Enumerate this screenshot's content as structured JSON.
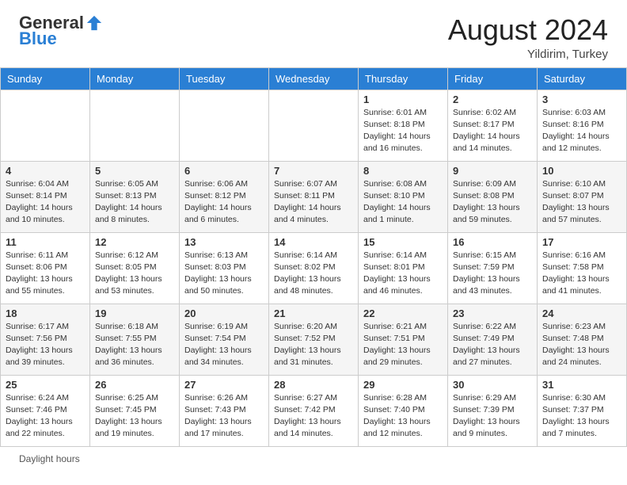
{
  "header": {
    "logo_general": "General",
    "logo_blue": "Blue",
    "month_year": "August 2024",
    "location": "Yildirim, Turkey"
  },
  "days_of_week": [
    "Sunday",
    "Monday",
    "Tuesday",
    "Wednesday",
    "Thursday",
    "Friday",
    "Saturday"
  ],
  "weeks": [
    [
      {
        "day": "",
        "info": ""
      },
      {
        "day": "",
        "info": ""
      },
      {
        "day": "",
        "info": ""
      },
      {
        "day": "",
        "info": ""
      },
      {
        "day": "1",
        "info": "Sunrise: 6:01 AM\nSunset: 8:18 PM\nDaylight: 14 hours\nand 16 minutes."
      },
      {
        "day": "2",
        "info": "Sunrise: 6:02 AM\nSunset: 8:17 PM\nDaylight: 14 hours\nand 14 minutes."
      },
      {
        "day": "3",
        "info": "Sunrise: 6:03 AM\nSunset: 8:16 PM\nDaylight: 14 hours\nand 12 minutes."
      }
    ],
    [
      {
        "day": "4",
        "info": "Sunrise: 6:04 AM\nSunset: 8:14 PM\nDaylight: 14 hours\nand 10 minutes."
      },
      {
        "day": "5",
        "info": "Sunrise: 6:05 AM\nSunset: 8:13 PM\nDaylight: 14 hours\nand 8 minutes."
      },
      {
        "day": "6",
        "info": "Sunrise: 6:06 AM\nSunset: 8:12 PM\nDaylight: 14 hours\nand 6 minutes."
      },
      {
        "day": "7",
        "info": "Sunrise: 6:07 AM\nSunset: 8:11 PM\nDaylight: 14 hours\nand 4 minutes."
      },
      {
        "day": "8",
        "info": "Sunrise: 6:08 AM\nSunset: 8:10 PM\nDaylight: 14 hours\nand 1 minute."
      },
      {
        "day": "9",
        "info": "Sunrise: 6:09 AM\nSunset: 8:08 PM\nDaylight: 13 hours\nand 59 minutes."
      },
      {
        "day": "10",
        "info": "Sunrise: 6:10 AM\nSunset: 8:07 PM\nDaylight: 13 hours\nand 57 minutes."
      }
    ],
    [
      {
        "day": "11",
        "info": "Sunrise: 6:11 AM\nSunset: 8:06 PM\nDaylight: 13 hours\nand 55 minutes."
      },
      {
        "day": "12",
        "info": "Sunrise: 6:12 AM\nSunset: 8:05 PM\nDaylight: 13 hours\nand 53 minutes."
      },
      {
        "day": "13",
        "info": "Sunrise: 6:13 AM\nSunset: 8:03 PM\nDaylight: 13 hours\nand 50 minutes."
      },
      {
        "day": "14",
        "info": "Sunrise: 6:14 AM\nSunset: 8:02 PM\nDaylight: 13 hours\nand 48 minutes."
      },
      {
        "day": "15",
        "info": "Sunrise: 6:14 AM\nSunset: 8:01 PM\nDaylight: 13 hours\nand 46 minutes."
      },
      {
        "day": "16",
        "info": "Sunrise: 6:15 AM\nSunset: 7:59 PM\nDaylight: 13 hours\nand 43 minutes."
      },
      {
        "day": "17",
        "info": "Sunrise: 6:16 AM\nSunset: 7:58 PM\nDaylight: 13 hours\nand 41 minutes."
      }
    ],
    [
      {
        "day": "18",
        "info": "Sunrise: 6:17 AM\nSunset: 7:56 PM\nDaylight: 13 hours\nand 39 minutes."
      },
      {
        "day": "19",
        "info": "Sunrise: 6:18 AM\nSunset: 7:55 PM\nDaylight: 13 hours\nand 36 minutes."
      },
      {
        "day": "20",
        "info": "Sunrise: 6:19 AM\nSunset: 7:54 PM\nDaylight: 13 hours\nand 34 minutes."
      },
      {
        "day": "21",
        "info": "Sunrise: 6:20 AM\nSunset: 7:52 PM\nDaylight: 13 hours\nand 31 minutes."
      },
      {
        "day": "22",
        "info": "Sunrise: 6:21 AM\nSunset: 7:51 PM\nDaylight: 13 hours\nand 29 minutes."
      },
      {
        "day": "23",
        "info": "Sunrise: 6:22 AM\nSunset: 7:49 PM\nDaylight: 13 hours\nand 27 minutes."
      },
      {
        "day": "24",
        "info": "Sunrise: 6:23 AM\nSunset: 7:48 PM\nDaylight: 13 hours\nand 24 minutes."
      }
    ],
    [
      {
        "day": "25",
        "info": "Sunrise: 6:24 AM\nSunset: 7:46 PM\nDaylight: 13 hours\nand 22 minutes."
      },
      {
        "day": "26",
        "info": "Sunrise: 6:25 AM\nSunset: 7:45 PM\nDaylight: 13 hours\nand 19 minutes."
      },
      {
        "day": "27",
        "info": "Sunrise: 6:26 AM\nSunset: 7:43 PM\nDaylight: 13 hours\nand 17 minutes."
      },
      {
        "day": "28",
        "info": "Sunrise: 6:27 AM\nSunset: 7:42 PM\nDaylight: 13 hours\nand 14 minutes."
      },
      {
        "day": "29",
        "info": "Sunrise: 6:28 AM\nSunset: 7:40 PM\nDaylight: 13 hours\nand 12 minutes."
      },
      {
        "day": "30",
        "info": "Sunrise: 6:29 AM\nSunset: 7:39 PM\nDaylight: 13 hours\nand 9 minutes."
      },
      {
        "day": "31",
        "info": "Sunrise: 6:30 AM\nSunset: 7:37 PM\nDaylight: 13 hours\nand 7 minutes."
      }
    ]
  ],
  "footer": {
    "daylight_label": "Daylight hours"
  }
}
